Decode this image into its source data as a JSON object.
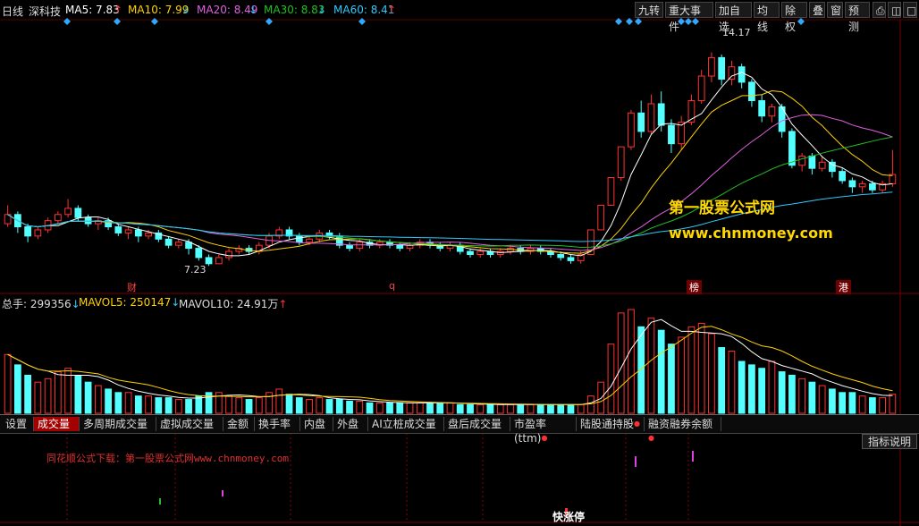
{
  "header": {
    "period": "日线",
    "stock": "深科技",
    "ma": [
      {
        "label": "MA5: 7.83",
        "arrow": "↑",
        "color": "#ffffff"
      },
      {
        "label": "MA10: 7.99",
        "arrow": "↓",
        "color": "#ffd200"
      },
      {
        "label": "MA20: 8.49",
        "arrow": "↓",
        "color": "#e060e0"
      },
      {
        "label": "MA30: 8.83",
        "arrow": "↓",
        "color": "#20c020"
      },
      {
        "label": "MA60: 8.41",
        "arrow": "↑",
        "color": "#30c8ff"
      }
    ],
    "buttons": [
      "九转",
      "重大事件",
      "加自选",
      "均线",
      "除权",
      "叠",
      "窗",
      "预测"
    ]
  },
  "price_labels": {
    "high": "14.17",
    "low": "7.23"
  },
  "event_tags": [
    "财",
    "q",
    "榜",
    "港"
  ],
  "volume_header": {
    "total": "总手: 299356",
    "total_arrow": "↓",
    "mavol5": "MAVOL5: 250147",
    "mavol5_arrow": "↓",
    "mavol10": "MAVOL10: 24.91万",
    "mavol10_arrow": "↑"
  },
  "tabs": [
    "设置",
    "成交量",
    "多周期成交量",
    "虚拟成交量",
    "金额",
    "换手率",
    "内盘",
    "外盘",
    "AI立桩成交量",
    "盘后成交量",
    "市盈率(ttm)",
    "陆股通持股",
    "融资融券余额"
  ],
  "indicator_help": "指标说明",
  "formula": {
    "prefix": "同花顺公式下载：第一股票公式网",
    "url": "www.chnmoney.com"
  },
  "watermark": {
    "title": "第一股票公式网",
    "url": "www.chnmoney.com"
  },
  "bottom_tag": "快涨停",
  "colors": {
    "up": "#ff3232",
    "down": "#54ffff",
    "ma5": "#ffffff",
    "ma10": "#ffd200",
    "ma20": "#e060e0",
    "ma30": "#20c020",
    "ma60": "#30c8ff"
  },
  "chart_data": {
    "type": "candlestick",
    "candles": [
      [
        8.6,
        8.9,
        9.2,
        8.5
      ],
      [
        8.9,
        8.5,
        9.0,
        8.3
      ],
      [
        8.5,
        8.2,
        8.6,
        8.0
      ],
      [
        8.2,
        8.4,
        8.5,
        8.1
      ],
      [
        8.4,
        8.7,
        8.8,
        8.3
      ],
      [
        8.7,
        8.9,
        9.0,
        8.6
      ],
      [
        8.9,
        9.1,
        9.4,
        8.8
      ],
      [
        9.1,
        8.8,
        9.2,
        8.7
      ],
      [
        8.8,
        8.6,
        8.9,
        8.5
      ],
      [
        8.6,
        8.7,
        8.8,
        8.4
      ],
      [
        8.7,
        8.5,
        8.8,
        8.4
      ],
      [
        8.5,
        8.3,
        8.6,
        8.2
      ],
      [
        8.3,
        8.4,
        8.5,
        8.1
      ],
      [
        8.4,
        8.2,
        8.5,
        8.0
      ],
      [
        8.2,
        8.3,
        8.4,
        8.1
      ],
      [
        8.3,
        8.1,
        8.4,
        8.0
      ],
      [
        8.1,
        7.9,
        8.2,
        7.8
      ],
      [
        7.9,
        8.0,
        8.1,
        7.8
      ],
      [
        8.0,
        7.8,
        8.1,
        7.6
      ],
      [
        7.8,
        7.5,
        7.9,
        7.4
      ],
      [
        7.5,
        7.3,
        7.6,
        7.23
      ],
      [
        7.3,
        7.5,
        7.6,
        7.3
      ],
      [
        7.5,
        7.7,
        7.8,
        7.4
      ],
      [
        7.7,
        7.8,
        7.9,
        7.6
      ],
      [
        7.8,
        7.7,
        7.9,
        7.6
      ],
      [
        7.7,
        7.9,
        8.0,
        7.6
      ],
      [
        7.9,
        8.2,
        8.3,
        7.8
      ],
      [
        8.2,
        8.4,
        8.5,
        8.1
      ],
      [
        8.4,
        8.2,
        8.5,
        8.1
      ],
      [
        8.2,
        8.0,
        8.3,
        7.9
      ],
      [
        8.0,
        8.1,
        8.2,
        7.9
      ],
      [
        8.1,
        8.3,
        8.4,
        8.0
      ],
      [
        8.3,
        8.2,
        8.4,
        8.1
      ],
      [
        8.2,
        7.9,
        8.3,
        7.8
      ],
      [
        7.9,
        7.8,
        8.0,
        7.7
      ],
      [
        7.8,
        8.0,
        8.1,
        7.7
      ],
      [
        8.0,
        7.9,
        8.1,
        7.8
      ],
      [
        7.9,
        8.0,
        8.1,
        7.8
      ],
      [
        8.0,
        7.9,
        8.1,
        7.8
      ],
      [
        7.9,
        7.8,
        8.0,
        7.7
      ],
      [
        7.8,
        7.9,
        8.0,
        7.7
      ],
      [
        7.9,
        8.0,
        8.1,
        7.8
      ],
      [
        8.0,
        7.9,
        8.1,
        7.8
      ],
      [
        7.9,
        7.8,
        8.0,
        7.7
      ],
      [
        7.8,
        7.9,
        8.0,
        7.7
      ],
      [
        7.9,
        7.7,
        8.0,
        7.6
      ],
      [
        7.7,
        7.6,
        7.8,
        7.5
      ],
      [
        7.6,
        7.7,
        7.8,
        7.5
      ],
      [
        7.7,
        7.6,
        7.8,
        7.5
      ],
      [
        7.6,
        7.7,
        7.8,
        7.5
      ],
      [
        7.7,
        7.8,
        7.9,
        7.6
      ],
      [
        7.8,
        7.7,
        7.9,
        7.6
      ],
      [
        7.7,
        7.8,
        7.9,
        7.6
      ],
      [
        7.8,
        7.7,
        7.9,
        7.6
      ],
      [
        7.7,
        7.6,
        7.8,
        7.5
      ],
      [
        7.6,
        7.5,
        7.7,
        7.4
      ],
      [
        7.5,
        7.4,
        7.6,
        7.3
      ],
      [
        7.4,
        7.6,
        7.7,
        7.3
      ],
      [
        7.6,
        8.4,
        8.4,
        7.6
      ],
      [
        8.4,
        9.2,
        9.2,
        8.4
      ],
      [
        9.2,
        10.1,
        10.1,
        9.2
      ],
      [
        10.1,
        11.1,
        11.1,
        10.0
      ],
      [
        11.1,
        12.2,
        12.3,
        11.0
      ],
      [
        12.2,
        11.6,
        12.6,
        11.4
      ],
      [
        11.6,
        12.5,
        12.8,
        11.5
      ],
      [
        12.5,
        11.8,
        12.9,
        11.6
      ],
      [
        11.8,
        11.2,
        12.0,
        10.9
      ],
      [
        11.2,
        11.9,
        12.1,
        11.0
      ],
      [
        11.9,
        12.6,
        12.8,
        11.8
      ],
      [
        12.6,
        13.4,
        13.6,
        12.5
      ],
      [
        13.4,
        14.0,
        14.17,
        13.2
      ],
      [
        14.0,
        13.3,
        14.1,
        13.1
      ],
      [
        13.3,
        13.7,
        13.9,
        13.1
      ],
      [
        13.7,
        13.2,
        13.8,
        13.0
      ],
      [
        13.2,
        12.6,
        13.3,
        12.4
      ],
      [
        12.6,
        12.1,
        12.8,
        11.9
      ],
      [
        12.1,
        12.4,
        12.5,
        11.9
      ],
      [
        12.4,
        11.6,
        12.5,
        11.4
      ],
      [
        11.6,
        10.5,
        11.7,
        10.4
      ],
      [
        10.5,
        10.8,
        10.9,
        10.3
      ],
      [
        10.8,
        10.4,
        10.9,
        10.2
      ],
      [
        10.4,
        10.6,
        10.8,
        10.3
      ],
      [
        10.6,
        10.3,
        10.7,
        10.1
      ],
      [
        10.3,
        10.0,
        10.4,
        9.9
      ],
      [
        10.0,
        9.8,
        10.1,
        9.6
      ],
      [
        9.8,
        9.9,
        10.0,
        9.6
      ],
      [
        9.9,
        9.7,
        10.0,
        9.6
      ],
      [
        9.7,
        9.9,
        10.0,
        9.6
      ],
      [
        9.9,
        10.2,
        11.0,
        9.8
      ]
    ],
    "volumes": [
      34,
      28,
      22,
      18,
      20,
      24,
      26,
      22,
      18,
      16,
      14,
      12,
      12,
      10,
      10,
      9,
      9,
      8,
      8,
      10,
      12,
      12,
      10,
      9,
      8,
      9,
      12,
      14,
      11,
      9,
      8,
      9,
      8,
      8,
      7,
      7,
      6,
      6,
      6,
      6,
      6,
      6,
      6,
      6,
      6,
      5,
      5,
      5,
      5,
      5,
      5,
      5,
      5,
      5,
      5,
      5,
      5,
      5,
      10,
      18,
      40,
      58,
      60,
      50,
      55,
      48,
      40,
      44,
      50,
      52,
      46,
      38,
      36,
      30,
      28,
      26,
      30,
      24,
      22,
      20,
      18,
      16,
      14,
      12,
      12,
      10,
      9,
      9,
      11
    ],
    "price_range": [
      6.8,
      15.0
    ],
    "moving_averages": [
      "MA5",
      "MA10",
      "MA20",
      "MA30",
      "MA60"
    ]
  }
}
